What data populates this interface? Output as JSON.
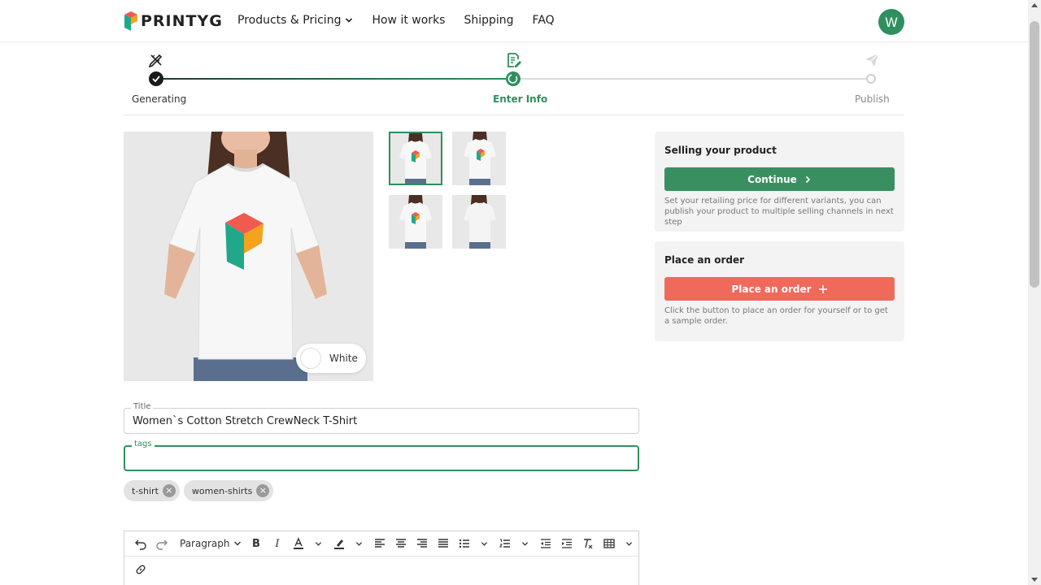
{
  "header": {
    "logo_text": "PRINTYG",
    "nav": [
      {
        "label": "Products & Pricing",
        "has_dropdown": true
      },
      {
        "label": "How it works"
      },
      {
        "label": "Shipping"
      },
      {
        "label": "FAQ"
      }
    ],
    "avatar_initial": "W"
  },
  "stepper": {
    "steps": [
      {
        "label": "Generating",
        "status": "done",
        "icon": "ruler-pencil-icon"
      },
      {
        "label": "Enter Info",
        "status": "active",
        "icon": "document-edit-icon"
      },
      {
        "label": "Publish",
        "status": "todo",
        "icon": "paper-plane-icon"
      }
    ]
  },
  "product": {
    "color_name": "White",
    "thumbnails_count": 4
  },
  "selling_card": {
    "title": "Selling your product",
    "button_label": "Continue",
    "note": "Set your retailing price for different variants, you can publish your product to multiple selling channels in next step"
  },
  "order_card": {
    "title": "Place an order",
    "button_label": "Place an order",
    "note": "Click the button to place an order for yourself or to get a sample order."
  },
  "form": {
    "title_label": "Title",
    "title_value": "Women`s Cotton Stretch CrewNeck T-Shirt",
    "tags_label": "tags",
    "tags_value": "",
    "tags": [
      "t-shirt",
      "women-shirts"
    ]
  },
  "editor": {
    "block_format": "Paragraph"
  },
  "colors": {
    "brand_green": "#2f8f5e",
    "cta_red": "#ef6a5b"
  }
}
